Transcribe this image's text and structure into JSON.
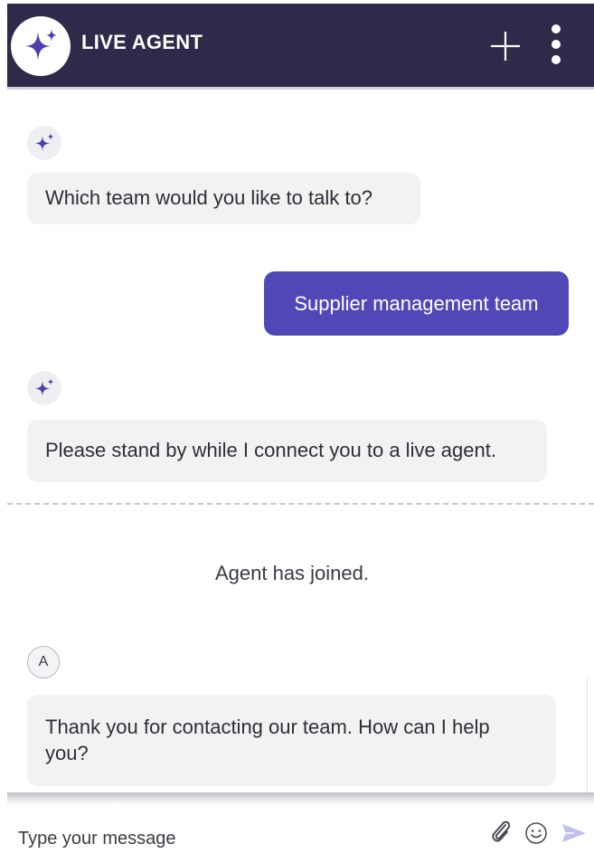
{
  "header": {
    "title": "LIVE AGENT",
    "logo_icon": "sparkle-icon",
    "add_icon": "plus-icon",
    "menu_icon": "vertical-dots-icon",
    "background": "#2d2a4a"
  },
  "messages": [
    {
      "sender": "bot",
      "text": "Which team would you like to talk to?"
    },
    {
      "sender": "user",
      "text": "Supplier management team"
    },
    {
      "sender": "bot",
      "text": "Please stand by while I connect you to a live agent."
    },
    {
      "sender": "system",
      "text": "Agent has joined."
    },
    {
      "sender": "agent",
      "avatar_initial": "A",
      "text": "Thank you for contacting our team. How can I help you?"
    }
  ],
  "composer": {
    "placeholder": "Type your message",
    "value": "",
    "attach_icon": "paperclip-icon",
    "emoji_icon": "smiley-icon",
    "send_icon": "send-icon"
  },
  "colors": {
    "accent": "#5148b8",
    "bot_bubble": "#f2f2f3"
  }
}
